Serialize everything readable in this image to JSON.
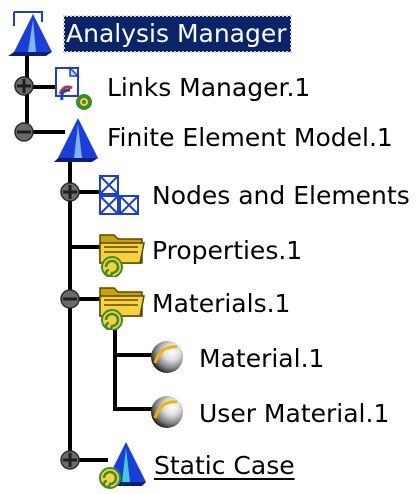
{
  "specification_tree": {
    "root": {
      "label": "Analysis Manager",
      "icon": "analysis-manager-icon",
      "selected": true
    },
    "nodes": [
      {
        "id": "links-manager",
        "label": "Links Manager.1",
        "icon": "links-manager-icon",
        "expander": "plus"
      },
      {
        "id": "finite-element-model",
        "label": "Finite Element Model.1",
        "icon": "finite-element-model-icon",
        "expander": "minus"
      },
      {
        "id": "nodes-and-elements",
        "label": "Nodes and Elements",
        "icon": "nodes-and-elements-icon",
        "expander": "plus"
      },
      {
        "id": "properties",
        "label": "Properties.1",
        "icon": "properties-folder-icon",
        "expander": "none"
      },
      {
        "id": "materials",
        "label": "Materials.1",
        "icon": "materials-folder-icon",
        "expander": "minus"
      },
      {
        "id": "material",
        "label": "Material.1",
        "icon": "material-sphere-icon",
        "expander": "none"
      },
      {
        "id": "user-material",
        "label": "User Material.1",
        "icon": "user-material-sphere-icon",
        "expander": "none"
      },
      {
        "id": "static-case",
        "label": "Static Case",
        "icon": "static-case-icon",
        "expander": "plus",
        "underlined": true
      }
    ]
  },
  "colors": {
    "selection_background": "#0a246a",
    "selection_text": "#ffffff",
    "tree_lines": "#000000",
    "icon_blue": "#1a3fd8",
    "folder_yellow": "#f7d23e",
    "folder_dark": "#8a6d00",
    "spiral_green": "#3c8c2c"
  }
}
